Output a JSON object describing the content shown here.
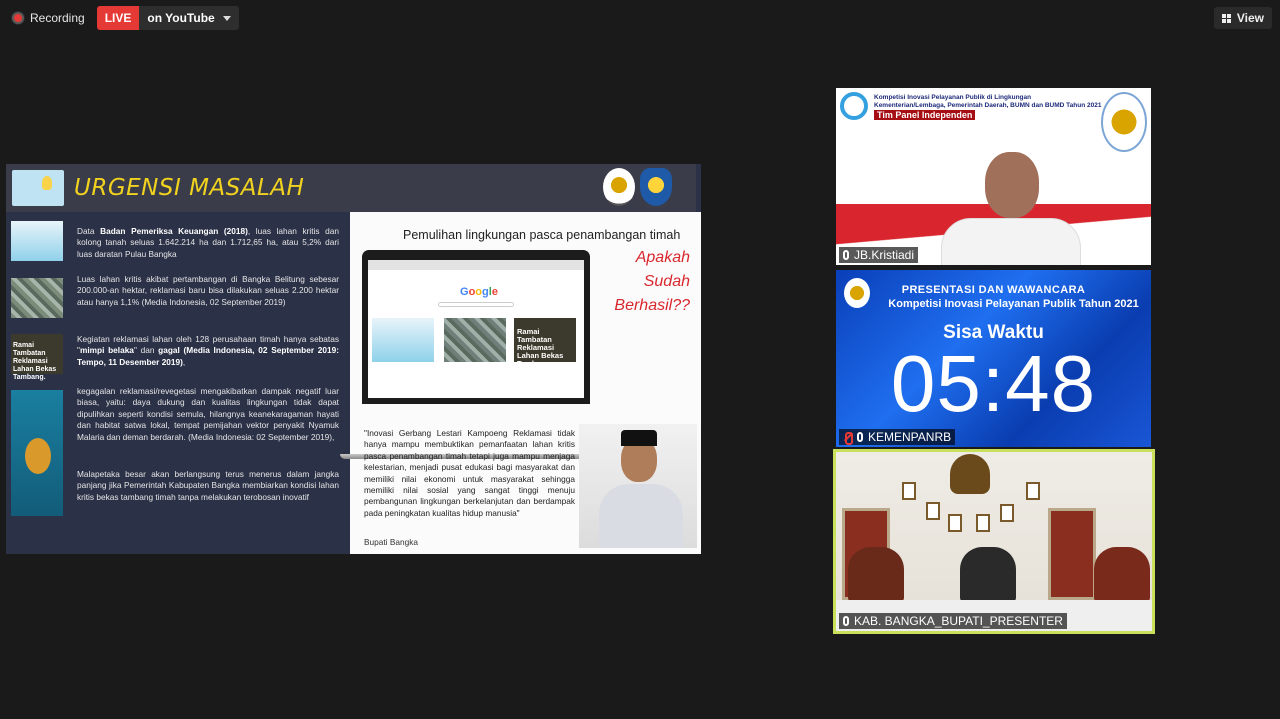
{
  "topbar": {
    "recording_label": "Recording",
    "live_badge": "LIVE",
    "live_destination": "on YouTube",
    "view_label": "View"
  },
  "slide": {
    "title": "URGENSI MASALAH",
    "paragraphs": [
      {
        "pre": "Data ",
        "bold": "Badan Pemeriksa Keuangan (2018)",
        "post": ", luas lahan kritis dan kolong tanah seluas 1.642.214 ha dan 1.712,65 ha, atau 5,2% dari luas daratan Pulau Bangka"
      },
      {
        "pre": "Luas lahan kritis akibat pertambangan di Bangka Belitung sebesar 200.000-an hektar, reklamasi baru bisa dilakukan seluas 2.200 hektar atau hanya 1,1% (Media Indonesia, 02 September 2019)",
        "bold": "",
        "post": ""
      },
      {
        "pre": "Kegiatan reklamasi lahan oleh 128 perusahaan timah hanya sebatas \"",
        "bold": "mimpi belaka",
        "post": "\" dan ",
        "bold2": "gagal (Media Indonesia, 02 September 2019: Tempo, 11 Desember 2019)",
        "post2": ","
      },
      {
        "pre": "kegagalan reklamasi/revegetasi mengakibatkan dampak negatif luar biasa, yaitu: daya dukung dan kualitas lingkungan tidak dapat dipulihkan seperti kondisi semula, hilangnya keanekaragaman hayati dan habitat satwa lokal, tempat pemijahan vektor penyakit Nyamuk Malaria dan deman berdarah. (Media Indonesia: 02 September 2019),",
        "bold": "",
        "post": ""
      },
      {
        "pre": "Malapetaka besar akan berlangsung terus menerus dalam jangka panjang jika Pemerintah Kabupaten Bangka membiarkan kondisi lahan kritis bekas tambang timah tanpa melakukan terobosan inovatif",
        "bold": "",
        "post": ""
      }
    ],
    "thumb3_text": "Ramai Tambatan Reklamasi Lahan Bekas Tambang.",
    "right_title": "Pemulihan lingkungan pasca penambangan timah",
    "right_question": [
      "Apakah",
      "Sudah",
      "Berhasil??"
    ],
    "google_text": [
      "G",
      "o",
      "o",
      "g",
      "l",
      "e"
    ],
    "screen_card_text": "Ramai Tambatan Reklamasi Lahan Bekas Tambang.",
    "quote": "\"Inovasi Gerbang Lestari Kampoeng Reklamasi tidak hanya mampu membuktikan pemanfaatan lahan kritis pasca penambangan timah tetapi juga mampu menjaga kelestarian, menjadi pusat edukasi bagi masyarakat dan memiliki nilai ekonomi  untuk masyarakat sehingga memiliki nilai sosial yang sangat tinggi menuju pembangunan lingkungan berkelanjutan dan berdampak pada peningkatan kualitas hidup manusia\"",
    "quote_source": "Bupati Bangka"
  },
  "tiles": {
    "t1": {
      "header_lines": [
        "Kompetisi Inovasi Pelayanan Publik di Lingkungan",
        "Kementerian/Lembaga, Pemerintah Daerah, BUMN dan BUMD Tahun 2021"
      ],
      "panel_label": "Tim Panel Independen",
      "name": "JB.Kristiadi"
    },
    "t2": {
      "line1": "PRESENTASI DAN WAWANCARA",
      "line2": "Kompetisi Inovasi Pelayanan Publik Tahun 2021",
      "sisa_label": "Sisa Waktu",
      "time": "05:48",
      "name": "KEMENPANRB"
    },
    "t3": {
      "name": "KAB. BANGKA_BUPATI_PRESENTER"
    }
  },
  "colors": {
    "live_red": "#e53935",
    "title_yellow": "#f1d21e",
    "question_red": "#d9272e",
    "active_speaker_border": "#c8e05a"
  }
}
